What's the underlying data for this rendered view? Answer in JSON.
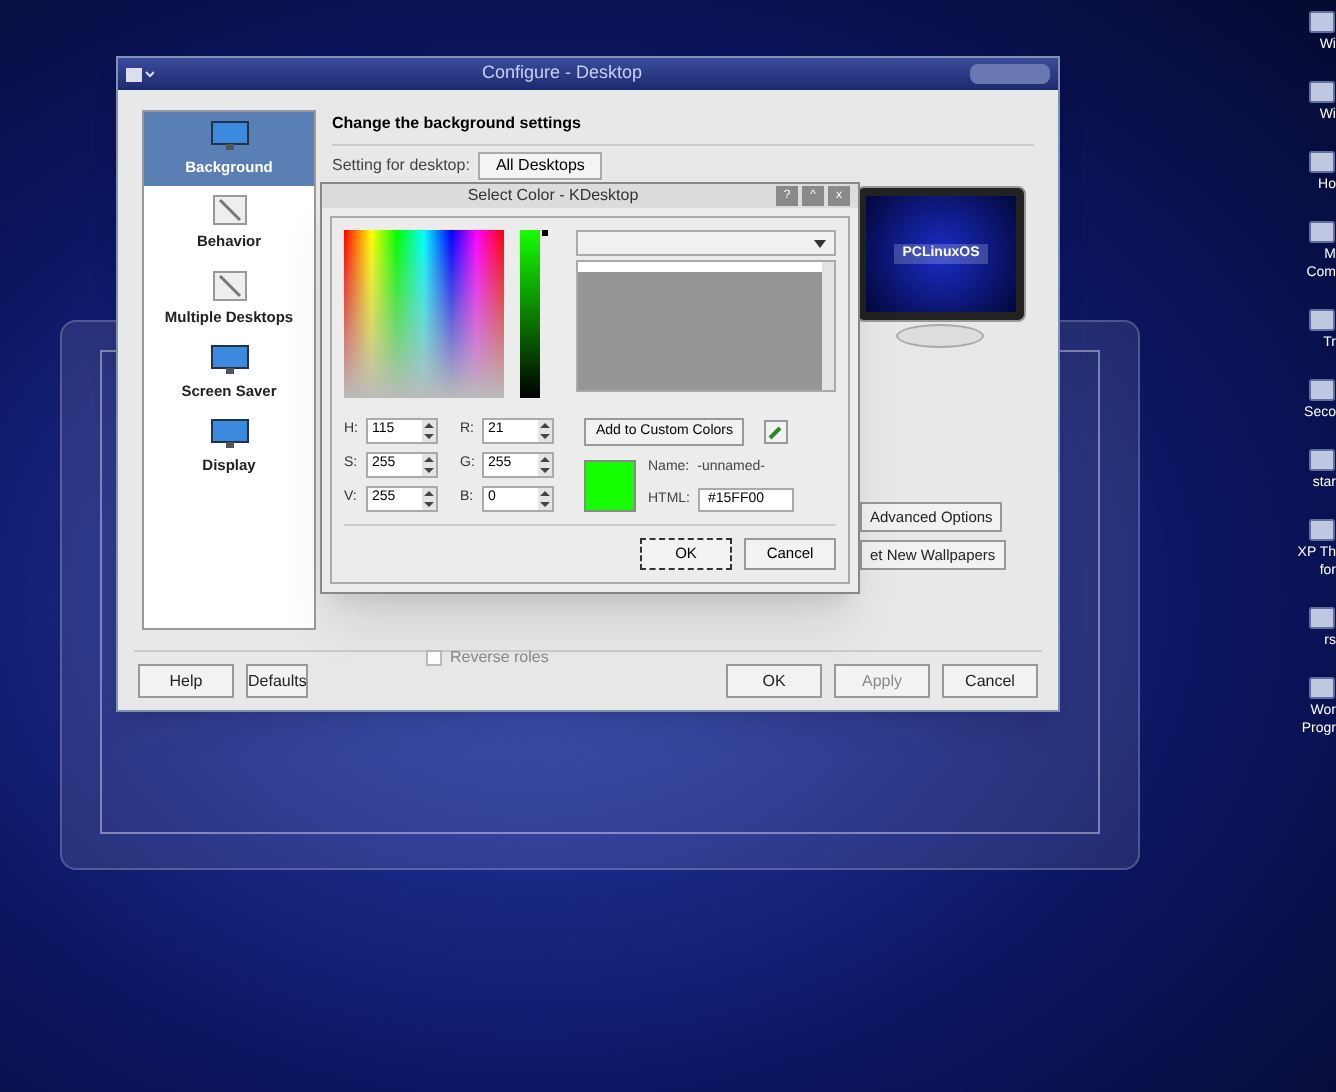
{
  "window": {
    "title": "Configure - Desktop"
  },
  "sidebar": {
    "items": [
      {
        "label": "Background",
        "selected": true
      },
      {
        "label": "Behavior",
        "selected": false
      },
      {
        "label": "Multiple Desktops",
        "selected": false
      },
      {
        "label": "Screen Saver",
        "selected": false
      },
      {
        "label": "Display",
        "selected": false
      }
    ]
  },
  "heading": "Change the background settings",
  "setting": {
    "label": "Setting for desktop:",
    "value": "All Desktops"
  },
  "preview": {
    "logo_text": "PCLinuxOS"
  },
  "side_buttons": [
    "Advanced Options",
    "et New Wallpapers"
  ],
  "reverse_roles": {
    "label": "Reverse roles",
    "checked": false,
    "disabled": true
  },
  "bottom_buttons": [
    {
      "label": "Help",
      "disabled": false
    },
    {
      "label": "Defaults",
      "disabled": false
    },
    {
      "label": "OK",
      "disabled": false
    },
    {
      "label": "Apply",
      "disabled": true
    },
    {
      "label": "Cancel",
      "disabled": false
    }
  ],
  "dialog": {
    "title": "Select Color - KDesktop",
    "title_buttons": [
      "?",
      "^",
      "x"
    ],
    "value_slider": {
      "level": 1
    },
    "spinboxes": [
      {
        "label": "H:",
        "value": "115"
      },
      {
        "label": "R:",
        "value": "21"
      },
      {
        "label": "S:",
        "value": "255"
      },
      {
        "label": "G:",
        "value": "255"
      },
      {
        "label": "V:",
        "value": "255"
      },
      {
        "label": "B:",
        "value": "0"
      }
    ],
    "add_button": "Add to Custom Colors",
    "name_label": "Name:",
    "name_value": "-unnamed-",
    "html_label": "HTML:",
    "html_value": "#15FF00",
    "buttons": [
      "OK",
      "Cancel"
    ]
  },
  "desktop_icons": [
    {
      "lines": [
        "Wi"
      ]
    },
    {
      "lines": [
        "Wi"
      ]
    },
    {
      "lines": [
        "Ho"
      ]
    },
    {
      "lines": [
        "M",
        "Com"
      ]
    },
    {
      "lines": [
        "Tr"
      ]
    },
    {
      "lines": [
        "Seco"
      ]
    },
    {
      "lines": [
        "star"
      ]
    },
    {
      "lines": [
        "XP Th",
        "for"
      ]
    },
    {
      "lines": [
        "rs"
      ]
    },
    {
      "lines": [
        "Wor",
        "Progr"
      ]
    }
  ]
}
